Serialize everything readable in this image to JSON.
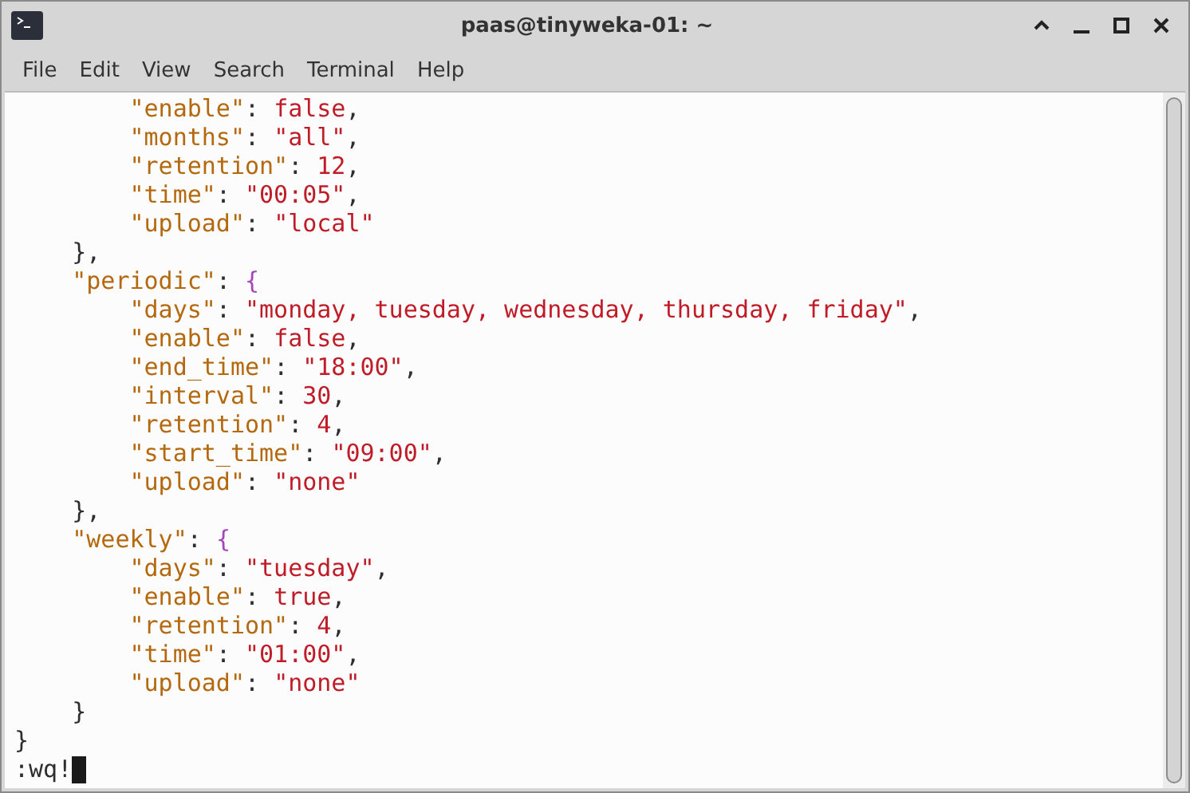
{
  "window": {
    "title": "paas@tinyweka-01: ~",
    "controls": [
      {
        "kind": "up"
      },
      {
        "kind": "minimize"
      },
      {
        "kind": "maximize"
      },
      {
        "kind": "close"
      }
    ]
  },
  "menu": [
    "File",
    "Edit",
    "View",
    "Search",
    "Terminal",
    "Help"
  ],
  "lines": [
    [
      {
        "kind": "key",
        "text": "        \"enable\""
      },
      {
        "kind": "punct",
        "text": ": "
      },
      {
        "kind": "value",
        "text": "false"
      },
      {
        "kind": "punct",
        "text": ","
      }
    ],
    [
      {
        "kind": "key",
        "text": "        \"months\""
      },
      {
        "kind": "punct",
        "text": ": "
      },
      {
        "kind": "value",
        "text": "\"all\""
      },
      {
        "kind": "punct",
        "text": ","
      }
    ],
    [
      {
        "kind": "key",
        "text": "        \"retention\""
      },
      {
        "kind": "punct",
        "text": ": "
      },
      {
        "kind": "value",
        "text": "12"
      },
      {
        "kind": "punct",
        "text": ","
      }
    ],
    [
      {
        "kind": "key",
        "text": "        \"time\""
      },
      {
        "kind": "punct",
        "text": ": "
      },
      {
        "kind": "value",
        "text": "\"00:05\""
      },
      {
        "kind": "punct",
        "text": ","
      }
    ],
    [
      {
        "kind": "key",
        "text": "        \"upload\""
      },
      {
        "kind": "punct",
        "text": ": "
      },
      {
        "kind": "value",
        "text": "\"local\""
      }
    ],
    [
      {
        "kind": "punct",
        "text": "    },"
      }
    ],
    [
      {
        "kind": "key",
        "text": "    \"periodic\""
      },
      {
        "kind": "punct",
        "text": ": "
      },
      {
        "kind": "brace",
        "text": "{"
      }
    ],
    [
      {
        "kind": "key",
        "text": "        \"days\""
      },
      {
        "kind": "punct",
        "text": ": "
      },
      {
        "kind": "value",
        "text": "\"monday, tuesday, wednesday, thursday, friday\""
      },
      {
        "kind": "punct",
        "text": ","
      }
    ],
    [
      {
        "kind": "key",
        "text": "        \"enable\""
      },
      {
        "kind": "punct",
        "text": ": "
      },
      {
        "kind": "value",
        "text": "false"
      },
      {
        "kind": "punct",
        "text": ","
      }
    ],
    [
      {
        "kind": "key",
        "text": "        \"end_time\""
      },
      {
        "kind": "punct",
        "text": ": "
      },
      {
        "kind": "value",
        "text": "\"18:00\""
      },
      {
        "kind": "punct",
        "text": ","
      }
    ],
    [
      {
        "kind": "key",
        "text": "        \"interval\""
      },
      {
        "kind": "punct",
        "text": ": "
      },
      {
        "kind": "value",
        "text": "30"
      },
      {
        "kind": "punct",
        "text": ","
      }
    ],
    [
      {
        "kind": "key",
        "text": "        \"retention\""
      },
      {
        "kind": "punct",
        "text": ": "
      },
      {
        "kind": "value",
        "text": "4"
      },
      {
        "kind": "punct",
        "text": ","
      }
    ],
    [
      {
        "kind": "key",
        "text": "        \"start_time\""
      },
      {
        "kind": "punct",
        "text": ": "
      },
      {
        "kind": "value",
        "text": "\"09:00\""
      },
      {
        "kind": "punct",
        "text": ","
      }
    ],
    [
      {
        "kind": "key",
        "text": "        \"upload\""
      },
      {
        "kind": "punct",
        "text": ": "
      },
      {
        "kind": "value",
        "text": "\"none\""
      }
    ],
    [
      {
        "kind": "punct",
        "text": "    },"
      }
    ],
    [
      {
        "kind": "key",
        "text": "    \"weekly\""
      },
      {
        "kind": "punct",
        "text": ": "
      },
      {
        "kind": "brace",
        "text": "{"
      }
    ],
    [
      {
        "kind": "key",
        "text": "        \"days\""
      },
      {
        "kind": "punct",
        "text": ": "
      },
      {
        "kind": "value",
        "text": "\"tuesday\""
      },
      {
        "kind": "punct",
        "text": ","
      }
    ],
    [
      {
        "kind": "key",
        "text": "        \"enable\""
      },
      {
        "kind": "punct",
        "text": ": "
      },
      {
        "kind": "value",
        "text": "true"
      },
      {
        "kind": "punct",
        "text": ","
      }
    ],
    [
      {
        "kind": "key",
        "text": "        \"retention\""
      },
      {
        "kind": "punct",
        "text": ": "
      },
      {
        "kind": "value",
        "text": "4"
      },
      {
        "kind": "punct",
        "text": ","
      }
    ],
    [
      {
        "kind": "key",
        "text": "        \"time\""
      },
      {
        "kind": "punct",
        "text": ": "
      },
      {
        "kind": "value",
        "text": "\"01:00\""
      },
      {
        "kind": "punct",
        "text": ","
      }
    ],
    [
      {
        "kind": "key",
        "text": "        \"upload\""
      },
      {
        "kind": "punct",
        "text": ": "
      },
      {
        "kind": "value",
        "text": "\"none\""
      }
    ],
    [
      {
        "kind": "punct",
        "text": "    }"
      }
    ],
    [
      {
        "kind": "punct",
        "text": "}"
      }
    ]
  ],
  "command": ":wq!"
}
